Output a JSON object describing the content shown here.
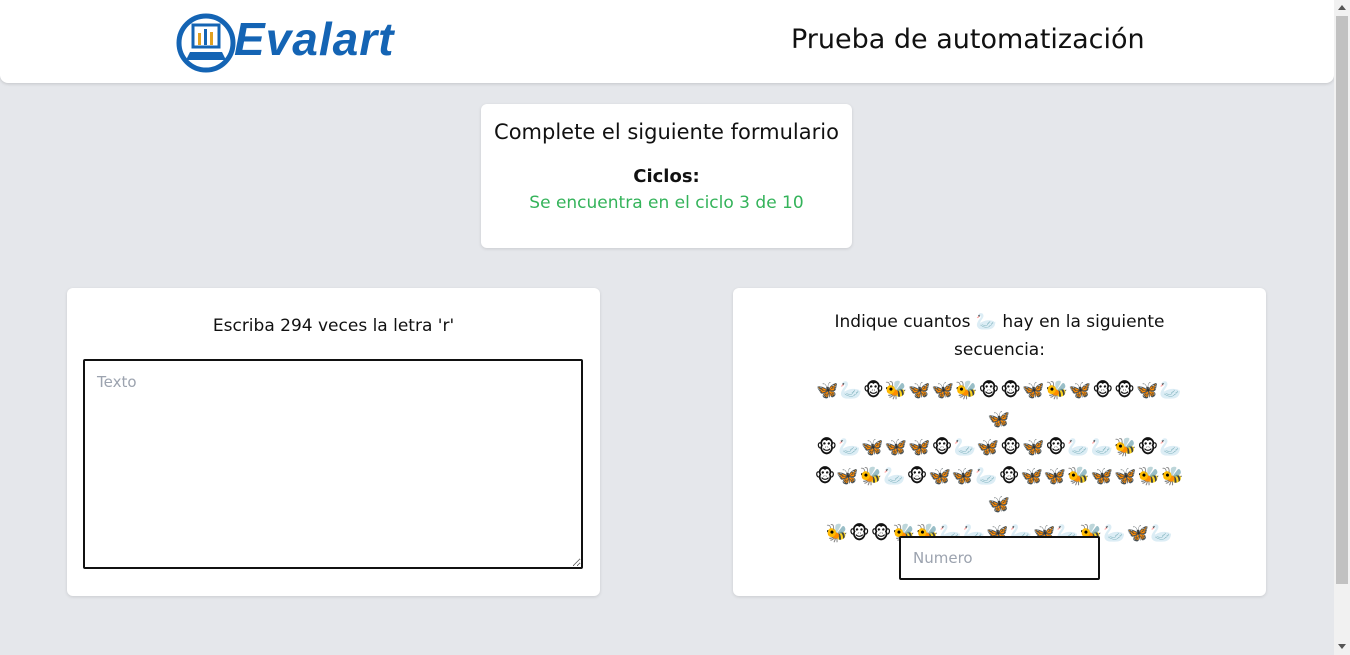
{
  "header": {
    "logo_text": "Evalart",
    "title": "Prueba de automatización"
  },
  "cycle": {
    "heading": "Complete el siguiente formulario",
    "label": "Ciclos:",
    "status": "Se encuentra en el ciclo 3 de 10",
    "status_color": "#34b35a"
  },
  "task_left": {
    "prompt": "Escriba 294 veces la letra 'r'",
    "placeholder": "Texto",
    "value": ""
  },
  "task_right": {
    "question": "Indique cuantos 🦢 hay en la siguiente secuencia:",
    "sequence": [
      "🦋🦢🐵🐝🦋🦋🐝🐵🐵🦋🐝🦋🐵🐵🦋🦢🦋",
      "🐵🦢🦋🦋🦋🐵🦢🦋🐵🦋🐵🦢🦢🐝🐵🦢",
      "🐵🦋🐝🦢🐵🦋🦋🦢🐵🦋🦋🐝🦋🦋🐝🐝🦋",
      "🐝🐵🐵🐝🐝🦢🦢🦋🦢🦋🦢🐝🦢🦋🦢",
      "🦢🦋🦢🦋🐝"
    ],
    "placeholder": "Numero",
    "value": ""
  },
  "icons": {
    "logo": "evalart-logo-icon",
    "scroll_up": "scroll-up-icon",
    "scroll_down": "scroll-down-icon"
  },
  "colors": {
    "brand": "#1464b4",
    "background": "#e5e7eb"
  }
}
